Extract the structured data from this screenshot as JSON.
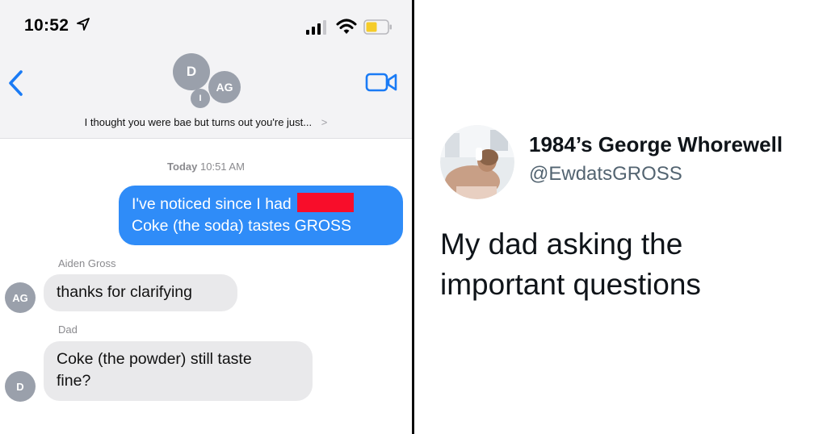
{
  "status_bar": {
    "time": "10:52",
    "location_arrow": "➤"
  },
  "conversation": {
    "avatars": {
      "d": "D",
      "ag": "AG",
      "i": "I"
    },
    "group_name": "I thought you were bae but turns out you're just...",
    "group_chevron": ">",
    "timestamp_day": "Today",
    "timestamp_time": "10:51 AM"
  },
  "messages": {
    "outgoing_line1": "I've noticed since I had",
    "outgoing_line2": "Coke (the soda) tastes GROSS",
    "aiden_sender": "Aiden Gross",
    "aiden_avatar": "AG",
    "aiden_text": "thanks for clarifying",
    "dad_sender": "Dad",
    "dad_avatar": "D",
    "dad_line1": "Coke (the powder) still taste",
    "dad_line2": "fine?"
  },
  "tweet": {
    "display_name": "1984’s George Whorewell",
    "handle": "@EwdatsGROSS",
    "text_line1": "My dad asking the",
    "text_line2": "important questions"
  },
  "colors": {
    "imessage_blue": "#2f8cf8",
    "ios_accent": "#1a7bf5",
    "redaction": "#f80d2a",
    "battery_low": "#f5cc2a",
    "incoming_bubble": "#e9e9eb"
  }
}
